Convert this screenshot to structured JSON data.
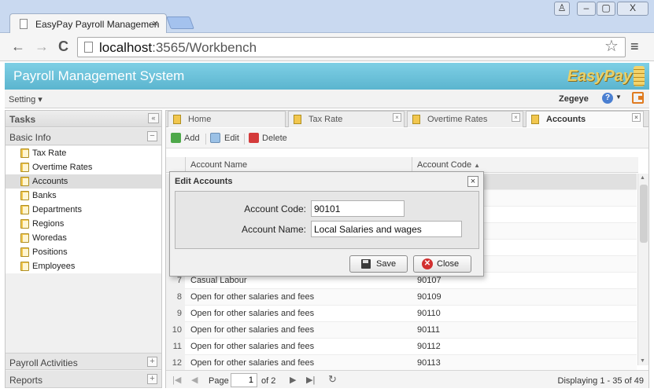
{
  "browser": {
    "tab_title": "EasyPay Payroll Managemen",
    "tab_close": "×",
    "url_host": "localhost",
    "url_path": ":3565/Workbench",
    "back": "←",
    "forward": "→",
    "reload": "C",
    "star": "☆",
    "menu": "≡",
    "window_buttons": [
      "♙",
      "–",
      "▢",
      "X"
    ]
  },
  "app": {
    "title": "Payroll Management System",
    "brand": "EasyPay",
    "setting_label": "Setting ▾",
    "user_name": "Zegeye",
    "help_label": "?",
    "help_caret": "▼"
  },
  "left_panel": {
    "header": "Tasks",
    "collapse": "«",
    "sections": {
      "basic_info": "Basic Info",
      "basic_info_btn": "−",
      "payroll_activities": "Payroll Activities",
      "payroll_btn": "+",
      "reports": "Reports",
      "reports_btn": "+"
    },
    "items": [
      {
        "label": "Tax Rate"
      },
      {
        "label": "Overtime Rates"
      },
      {
        "label": "Accounts"
      },
      {
        "label": "Banks"
      },
      {
        "label": "Departments"
      },
      {
        "label": "Regions"
      },
      {
        "label": "Woredas"
      },
      {
        "label": "Positions"
      },
      {
        "label": "Employees"
      }
    ]
  },
  "tabs": [
    {
      "label": "Home"
    },
    {
      "label": "Tax Rate"
    },
    {
      "label": "Overtime Rates"
    },
    {
      "label": "Accounts"
    }
  ],
  "tab_close": "×",
  "actions": {
    "add": "Add",
    "edit": "Edit",
    "delete": "Delete"
  },
  "grid": {
    "col_name": "Account Name",
    "col_code": "Account Code",
    "sort_indicator": "▲",
    "rows": [
      {
        "num": "",
        "name": "",
        "code": ""
      },
      {
        "num": "",
        "name": "",
        "code": ""
      },
      {
        "num": "",
        "name": "",
        "code": ""
      },
      {
        "num": "",
        "name": "",
        "code": ""
      },
      {
        "num": "",
        "name": "",
        "code": ""
      },
      {
        "num": "",
        "name": "",
        "code": ""
      },
      {
        "num": "7",
        "name": "Casual Labour",
        "code": "90107"
      },
      {
        "num": "8",
        "name": "Open for other salaries and fees",
        "code": "90109"
      },
      {
        "num": "9",
        "name": "Open for other salaries and fees",
        "code": "90110"
      },
      {
        "num": "10",
        "name": "Open for other salaries and fees",
        "code": "90111"
      },
      {
        "num": "11",
        "name": "Open for other salaries and fees",
        "code": "90112"
      },
      {
        "num": "12",
        "name": "Open for other salaries and fees",
        "code": "90113"
      }
    ]
  },
  "pager": {
    "first": "|◀",
    "prev": "◀",
    "page_label": "Page",
    "page_value": "1",
    "of_label": "of 2",
    "next": "▶",
    "last": "▶|",
    "refresh": "↻",
    "display_info": "Displaying 1 - 35 of 49"
  },
  "dialog": {
    "title": "Edit Accounts",
    "close": "×",
    "code_label": "Account Code:",
    "code_value": "90101",
    "name_label": "Account Name:",
    "name_value": "Local Salaries and wages",
    "save_label": "Save",
    "close_label": "Close"
  }
}
